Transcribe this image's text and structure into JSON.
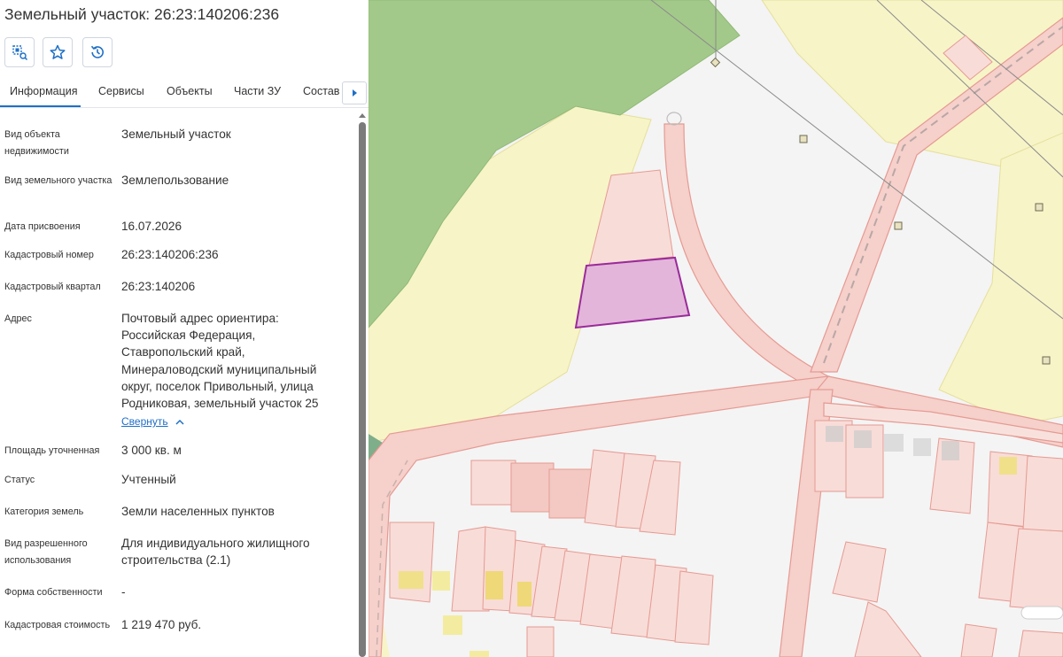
{
  "title": "Земельный участок: 26:23:140206:236",
  "toolbar": {
    "buttons": [
      {
        "name": "zoom-to-object-button",
        "icon": "zoom-to-object-icon"
      },
      {
        "name": "favorite-button",
        "icon": "star-icon"
      },
      {
        "name": "history-button",
        "icon": "history-icon"
      }
    ]
  },
  "tabs": [
    "Информация",
    "Сервисы",
    "Объекты",
    "Части ЗУ",
    "Состав"
  ],
  "active_tab": "Информация",
  "info": {
    "object_type": {
      "label": "Вид объекта недвижимости",
      "value": "Земельный участок"
    },
    "land_type": {
      "label": "Вид земельного участка",
      "value": "Землепользование"
    },
    "assign_date": {
      "label": "Дата присвоения",
      "value": "16.07.2026"
    },
    "cadastral_number": {
      "label": "Кадастровый номер",
      "value": "26:23:140206:236"
    },
    "cadastral_quarter": {
      "label": "Кадастровый квартал",
      "value": "26:23:140206"
    },
    "address": {
      "label": "Адрес",
      "value": "Почтовый адрес ориентира: Российская Федерация, Ставропольский край, Минераловодский муниципальный округ, поселок Привольный, улица Родниковая, земельный участок 25",
      "collapse_label": "Свернуть"
    },
    "area": {
      "label": "Площадь уточненная",
      "value": "3 000 кв. м"
    },
    "status": {
      "label": "Статус",
      "value": "Учтенный"
    },
    "land_category": {
      "label": "Категория земель",
      "value": "Земли населенных пунктов"
    },
    "permitted_use": {
      "label": "Вид разрешенного использования",
      "value": "Для индивидуального жилищного строительства (2.1)"
    },
    "ownership": {
      "label": "Форма собственности",
      "value": "-"
    },
    "cadastral_value": {
      "label": "Кадастровая стоимость",
      "value": "1 219 470 руб."
    }
  },
  "colors": {
    "accent": "#1f6fc7",
    "selected_parcel_fill": "#e3b5da",
    "selected_parcel_stroke": "#9a2a9a",
    "parcel_fill": "#f8dcd8",
    "parcel_stroke": "#e59a92",
    "zone_yellow": "#f7f4c8",
    "forest_green": "#a3c98a"
  }
}
